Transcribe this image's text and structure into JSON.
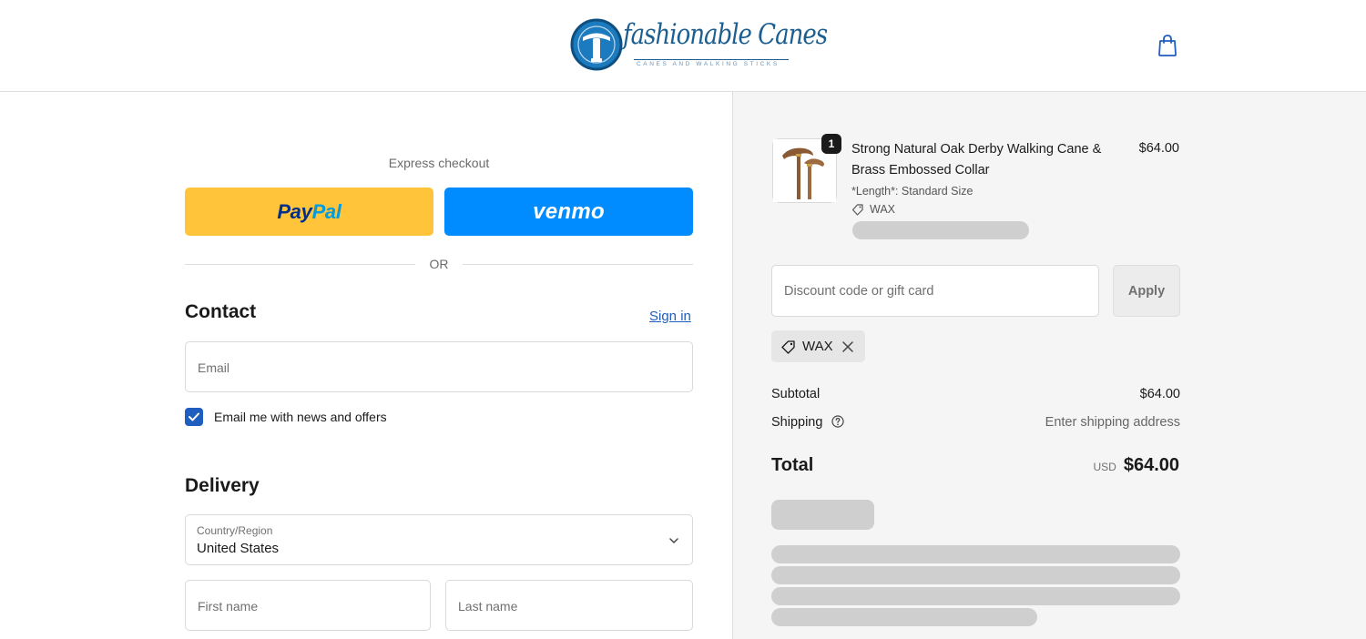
{
  "brand": {
    "name": "fashionable Canes",
    "tagline": "CANES AND WALKING STICKS",
    "color": "#1c5e8f"
  },
  "header": {
    "cart_icon": "shopping-bag-icon"
  },
  "express": {
    "label": "Express checkout",
    "paypal_pay": "Pay",
    "paypal_pal": "Pal",
    "venmo": "venmo",
    "or": "OR"
  },
  "contact": {
    "title": "Contact",
    "sign_in": "Sign in",
    "email_placeholder": "Email",
    "newsletter_label": "Email me with news and offers",
    "newsletter_checked": true
  },
  "delivery": {
    "title": "Delivery",
    "country_label": "Country/Region",
    "country_value": "United States",
    "first_name_placeholder": "First name",
    "last_name_placeholder": "Last name"
  },
  "order": {
    "item": {
      "name": "Strong Natural Oak Derby Walking Cane & Brass Embossed Collar",
      "price": "$64.00",
      "quantity": "1",
      "variant": "*Length*: Standard Size",
      "discount_tag": "WAX"
    },
    "discount_placeholder": "Discount code or gift card",
    "apply_label": "Apply",
    "applied_code": "WAX",
    "subtotal_label": "Subtotal",
    "subtotal_value": "$64.00",
    "shipping_label": "Shipping",
    "shipping_value": "Enter shipping address",
    "total_label": "Total",
    "total_currency": "USD",
    "total_value": "$64.00"
  },
  "colors": {
    "paypal": "#ffc439",
    "venmo": "#008cff",
    "link": "#1f5dbf",
    "summary_bg": "#f5f5f5"
  }
}
